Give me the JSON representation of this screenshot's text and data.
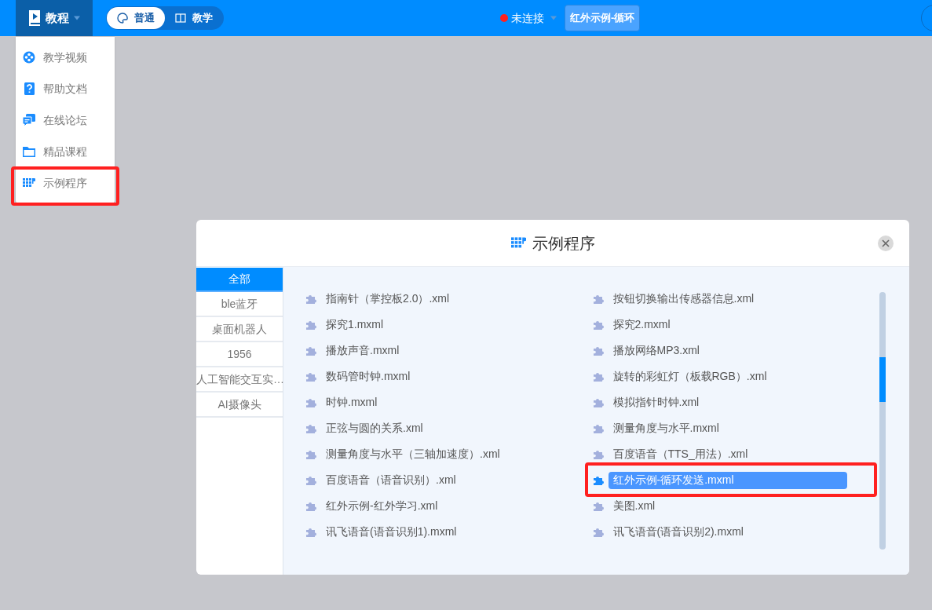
{
  "topbar": {
    "menu_button": {
      "label": "教程",
      "expanded": true
    },
    "modes": [
      {
        "label": "普通",
        "selected": true
      },
      {
        "label": "教学",
        "selected": false
      }
    ],
    "connection": {
      "label": "未连接",
      "connected": false
    },
    "file_button": {
      "label": "红外示例-循环"
    }
  },
  "menu": {
    "items": [
      {
        "label": "教学视频",
        "highlighted": false
      },
      {
        "label": "帮助文档",
        "highlighted": false
      },
      {
        "label": "在线论坛",
        "highlighted": false
      },
      {
        "label": "精品课程",
        "highlighted": false
      },
      {
        "label": "示例程序",
        "highlighted": true
      }
    ]
  },
  "dialog": {
    "title": "示例程序",
    "categories": [
      {
        "label": "全部",
        "selected": true
      },
      {
        "label": "ble蓝牙",
        "selected": false
      },
      {
        "label": "桌面机器人",
        "selected": false
      },
      {
        "label": "1956",
        "selected": false
      },
      {
        "label": "人工智能交互实…",
        "selected": false
      },
      {
        "label": "AI摄像头",
        "selected": false
      }
    ],
    "files": [
      {
        "name": "指南针（掌控板2.0）.xml",
        "selected": false,
        "highlighted": false
      },
      {
        "name": "按钮切换输出传感器信息.xml",
        "selected": false,
        "highlighted": false
      },
      {
        "name": "探究1.mxml",
        "selected": false,
        "highlighted": false
      },
      {
        "name": "探究2.mxml",
        "selected": false,
        "highlighted": false
      },
      {
        "name": "播放声音.mxml",
        "selected": false,
        "highlighted": false
      },
      {
        "name": "播放网络MP3.xml",
        "selected": false,
        "highlighted": false
      },
      {
        "name": "数码管时钟.mxml",
        "selected": false,
        "highlighted": false
      },
      {
        "name": "旋转的彩虹灯（板载RGB）.xml",
        "selected": false,
        "highlighted": false
      },
      {
        "name": "时钟.mxml",
        "selected": false,
        "highlighted": false
      },
      {
        "name": "模拟指针时钟.xml",
        "selected": false,
        "highlighted": false
      },
      {
        "name": "正弦与圆的关系.xml",
        "selected": false,
        "highlighted": false
      },
      {
        "name": "测量角度与水平.mxml",
        "selected": false,
        "highlighted": false
      },
      {
        "name": "测量角度与水平（三轴加速度）.xml",
        "selected": false,
        "highlighted": false
      },
      {
        "name": "百度语音（TTS_用法）.xml",
        "selected": false,
        "highlighted": false
      },
      {
        "name": "百度语音（语音识别）.xml",
        "selected": false,
        "highlighted": false
      },
      {
        "name": "红外示例-循环发送.mxml",
        "selected": true,
        "highlighted": true
      },
      {
        "name": "红外示例-红外学习.xml",
        "selected": false,
        "highlighted": false
      },
      {
        "name": "美图.xml",
        "selected": false,
        "highlighted": false
      },
      {
        "name": "讯飞语音(语音识别1).mxml",
        "selected": false,
        "highlighted": false
      },
      {
        "name": "讯飞语音(语音识别2).mxml",
        "selected": false,
        "highlighted": false
      }
    ]
  }
}
